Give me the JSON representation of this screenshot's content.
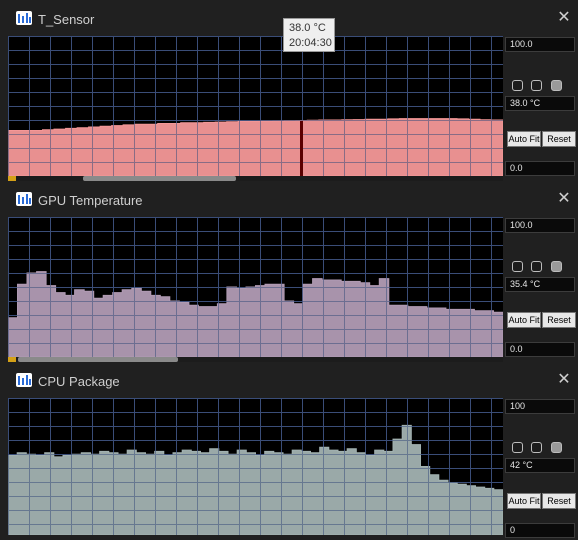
{
  "colors": {
    "t_sensor_fill": "#f49898",
    "gpu_fill": "#b19bb4",
    "cpu_fill": "#a2b2b1",
    "grid": "#3a4d78",
    "scroll_accent": "#d4a017"
  },
  "panels": [
    {
      "title": "T_Sensor",
      "max_value": "100.0",
      "current_value": "38.0 °C",
      "min_value": "0.0",
      "auto_fit_label": "Auto Fit",
      "reset_label": "Reset",
      "icon": "sensor-graph-icon",
      "close_icon": "close-icon",
      "ylim": [
        0,
        100
      ],
      "series": [
        32.5,
        32.5,
        32.5,
        33,
        33.5,
        34,
        34.5,
        35,
        35.5,
        36,
        36.5,
        37,
        37,
        37.5,
        37.5,
        38,
        38,
        38.3,
        38.5,
        38.7,
        39,
        39,
        39.2,
        39.3,
        39.5,
        39.6,
        39.8,
        40,
        40,
        40.2,
        40.3,
        40.5,
        40.6,
        40.8,
        41,
        41,
        41,
        41,
        41,
        40.8,
        40.5,
        40.2,
        40
      ]
    },
    {
      "title": "GPU Temperature",
      "max_value": "100.0",
      "current_value": "35.4 °C",
      "min_value": "0.0",
      "auto_fit_label": "Auto Fit",
      "reset_label": "Reset",
      "icon": "sensor-graph-icon",
      "close_icon": "close-icon",
      "ylim": [
        0,
        100
      ],
      "series": [
        28,
        52,
        60,
        61,
        51,
        46,
        44,
        48,
        47,
        42,
        44,
        46,
        48,
        49,
        47,
        44,
        43,
        40,
        39,
        37,
        36,
        36,
        38,
        50,
        49,
        50,
        51,
        52,
        52,
        40,
        38,
        52,
        56,
        55,
        55,
        54,
        54,
        53,
        51,
        56,
        37,
        37,
        36,
        36,
        35,
        35,
        34,
        34,
        34,
        33,
        33,
        32
      ]
    },
    {
      "title": "CPU Package",
      "max_value": "100",
      "current_value": "42 °C",
      "min_value": "0",
      "auto_fit_label": "Auto Fit",
      "reset_label": "Reset",
      "icon": "sensor-graph-icon",
      "close_icon": "close-icon",
      "ylim": [
        0,
        100
      ],
      "series": [
        58,
        60,
        59,
        58,
        60,
        57,
        58,
        59,
        60,
        59,
        61,
        60,
        59,
        62,
        60,
        59,
        61,
        58,
        60,
        62,
        61,
        60,
        63,
        61,
        59,
        62,
        60,
        58,
        61,
        60,
        59,
        62,
        61,
        60,
        64,
        62,
        61,
        63,
        60,
        58,
        62,
        61,
        70,
        80,
        66,
        50,
        44,
        40,
        38,
        37,
        36,
        35,
        34,
        33
      ]
    }
  ],
  "tooltip": {
    "value": "38.0 °C",
    "time": "20:04:30"
  }
}
